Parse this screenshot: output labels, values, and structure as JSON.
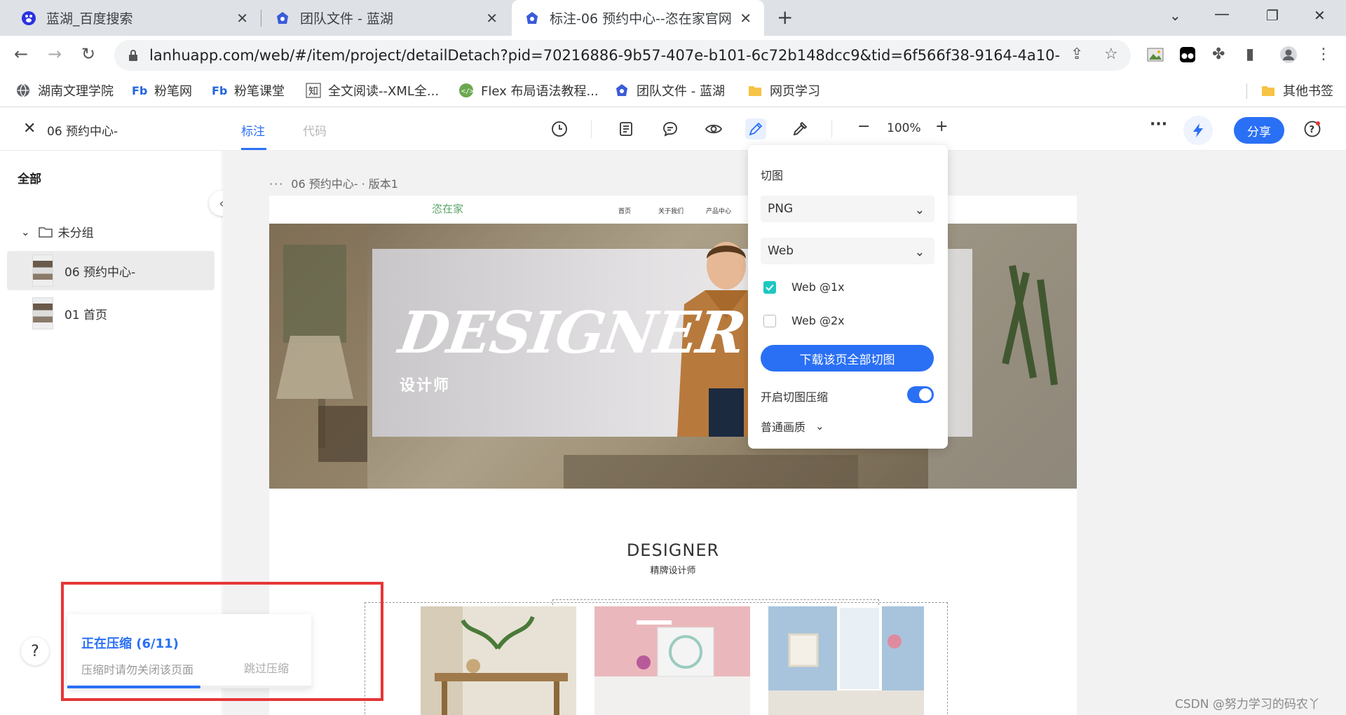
{
  "browser": {
    "tabs": [
      {
        "title": "蓝湖_百度搜索",
        "active": false
      },
      {
        "title": "团队文件 - 蓝湖",
        "active": false
      },
      {
        "title": "标注-06 预约中心--恣在家官网 -",
        "active": true
      }
    ],
    "new_tab": "+",
    "url": "lanhuapp.com/web/#/item/project/detailDetach?pid=70216886-9b57-407e-b101-6c72b148dcc9&tid=6f566f38-9164-4a10-b4...",
    "bookmarks": [
      {
        "label": "湖南文理学院",
        "icon": "globe-icon"
      },
      {
        "label": "粉笔网",
        "icon": "fenbi-icon"
      },
      {
        "label": "粉笔课堂",
        "icon": "fenbi-icon"
      },
      {
        "label": "全文阅读--XML全...",
        "icon": "zhi-icon"
      },
      {
        "label": "Flex 布局语法教程...",
        "icon": "code-icon"
      },
      {
        "label": "团队文件 - 蓝湖",
        "icon": "lanhu-icon"
      },
      {
        "label": "网页学习",
        "icon": "folder-icon"
      }
    ],
    "other_bookmarks": "其他书签"
  },
  "app": {
    "doc_title": "06 预约中心-",
    "tabs": [
      {
        "label": "标注",
        "active": true
      },
      {
        "label": "代码",
        "active": false
      }
    ],
    "zoom": "100%",
    "share_label": "分享",
    "accent": "#2a70f5"
  },
  "sidebar": {
    "all_label": "全部",
    "group_label": "未分组",
    "items": [
      {
        "label": "06 预约中心-",
        "active": true
      },
      {
        "label": "01 首页",
        "active": false
      }
    ]
  },
  "canvas": {
    "breadcrumb": "06 预约中心- · 版本1",
    "site": {
      "logo": "恣在家",
      "nav": [
        "首页",
        "关于我们",
        "产品中心"
      ],
      "hero_title": "DESIGNER",
      "hero_subtitle": "设计师",
      "section_title": "DESIGNER",
      "section_subtitle": "精牌设计师"
    }
  },
  "export_panel": {
    "title": "切图",
    "format": "PNG",
    "platform": "Web",
    "options": [
      {
        "label": "Web @1x",
        "checked": true
      },
      {
        "label": "Web @2x",
        "checked": false
      }
    ],
    "download_label": "下载该页全部切图",
    "compress_label": "开启切图压缩",
    "compress_on": true,
    "quality_label": "普通画质"
  },
  "toast": {
    "title": "正在压缩 (6/11)",
    "message": "压缩时请勿关闭该页面",
    "skip_label": "跳过压缩",
    "progress_fraction": 0.545
  },
  "help_label": "?",
  "watermark": "CSDN @努力学习的码农丫"
}
